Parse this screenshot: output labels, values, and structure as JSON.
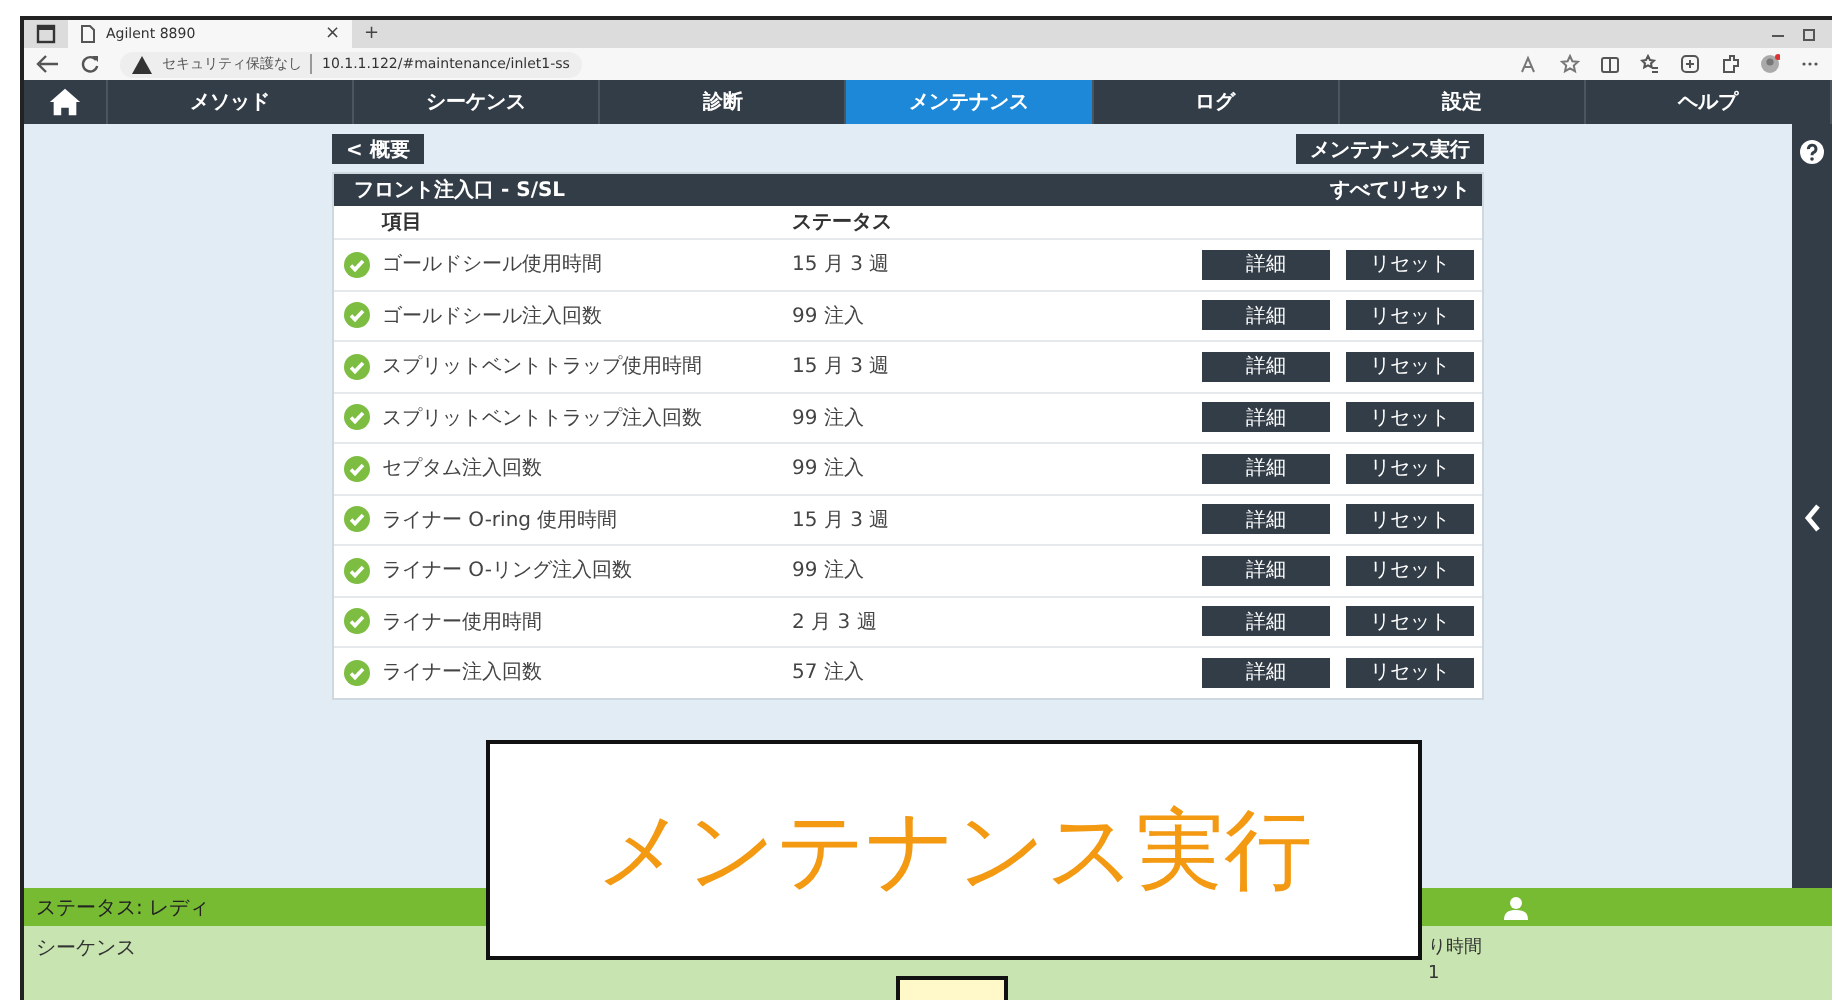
{
  "browser": {
    "tab_title": "Agilent 8890",
    "tab_close": "×",
    "new_tab": "+",
    "security": "セキュリティ保護なし",
    "url": "10.1.1.122/#maintenance/inlet1-ss"
  },
  "nav": [
    {
      "label": "メソッド",
      "selected": false
    },
    {
      "label": "シーケンス",
      "selected": false
    },
    {
      "label": "診断",
      "selected": false
    },
    {
      "label": "メンテナンス",
      "selected": true
    },
    {
      "label": "ログ",
      "selected": false
    },
    {
      "label": "設定",
      "selected": false
    },
    {
      "label": "ヘルプ",
      "selected": false
    }
  ],
  "toolbar": {
    "back": "< 概要",
    "run": "メンテナンス実行"
  },
  "panel": {
    "title": "フロント注入口 - S/SL",
    "reset_all": "すべてリセット",
    "columns": [
      "項目",
      "ステータス"
    ],
    "rows": [
      {
        "item": "ゴールドシール使用時間",
        "status": "15 月 3 週",
        "ok": true,
        "detail": "詳細",
        "reset": "リセット"
      },
      {
        "item": "ゴールドシール注入回数",
        "status": "99 注入",
        "ok": true,
        "detail": "詳細",
        "reset": "リセット"
      },
      {
        "item": "スプリットベントトラップ使用時間",
        "status": "15 月 3 週",
        "ok": true,
        "detail": "詳細",
        "reset": "リセット"
      },
      {
        "item": "スプリットベントトラップ注入回数",
        "status": "99 注入",
        "ok": true,
        "detail": "詳細",
        "reset": "リセット"
      },
      {
        "item": "セプタム注入回数",
        "status": "99 注入",
        "ok": true,
        "detail": "詳細",
        "reset": "リセット"
      },
      {
        "item": "ライナー O-ring 使用時間",
        "status": "15 月 3 週",
        "ok": true,
        "detail": "詳細",
        "reset": "リセット"
      },
      {
        "item": "ライナー O-リング注入回数",
        "status": "99 注入",
        "ok": true,
        "detail": "詳細",
        "reset": "リセット"
      },
      {
        "item": "ライナー使用時間",
        "status": "2 月 3 週",
        "ok": true,
        "detail": "詳細",
        "reset": "リセット"
      },
      {
        "item": "ライナー注入回数",
        "status": "57 注入",
        "ok": true,
        "detail": "詳細",
        "reset": "リセット"
      }
    ]
  },
  "status_bar": {
    "status": "ステータス: レディ",
    "sequence": "シーケンス",
    "remaining": "り時間",
    "remaining_value": "1"
  },
  "callout": "メンテナンス実行"
}
